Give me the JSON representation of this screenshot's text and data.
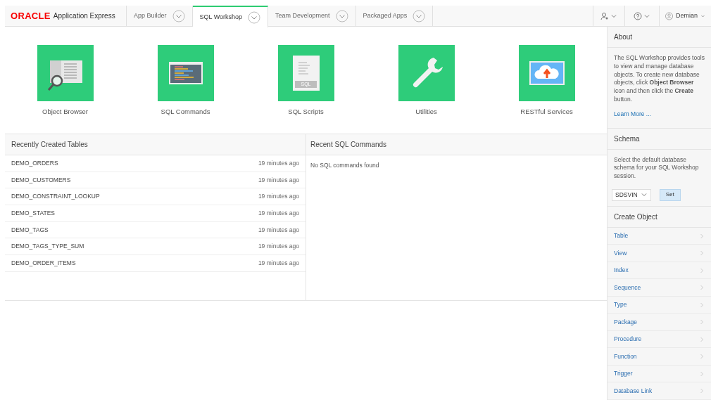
{
  "header": {
    "logo": "ORACLE",
    "product": "Application Express",
    "tabs": [
      {
        "label": "App Builder",
        "selected": false
      },
      {
        "label": "SQL Workshop",
        "selected": true
      },
      {
        "label": "Team Development",
        "selected": false
      },
      {
        "label": "Packaged Apps",
        "selected": false
      }
    ],
    "user": "Demian"
  },
  "tiles": [
    {
      "label": "Object Browser",
      "kind": "browser"
    },
    {
      "label": "SQL Commands",
      "kind": "commands"
    },
    {
      "label": "SQL Scripts",
      "kind": "scripts",
      "badge": "SQL"
    },
    {
      "label": "Utilities",
      "kind": "wrench"
    },
    {
      "label": "RESTful Services",
      "kind": "cloud"
    }
  ],
  "recent_tables": {
    "title": "Recently Created Tables",
    "rows": [
      {
        "name": "DEMO_ORDERS",
        "time": "19 minutes ago"
      },
      {
        "name": "DEMO_CUSTOMERS",
        "time": "19 minutes ago"
      },
      {
        "name": "DEMO_CONSTRAINT_LOOKUP",
        "time": "19 minutes ago"
      },
      {
        "name": "DEMO_STATES",
        "time": "19 minutes ago"
      },
      {
        "name": "DEMO_TAGS",
        "time": "19 minutes ago"
      },
      {
        "name": "DEMO_TAGS_TYPE_SUM",
        "time": "19 minutes ago"
      },
      {
        "name": "DEMO_ORDER_ITEMS",
        "time": "19 minutes ago"
      }
    ]
  },
  "recent_commands": {
    "title": "Recent SQL Commands",
    "empty": "No SQL commands found"
  },
  "sidebar": {
    "about": {
      "title": "About",
      "text": "The SQL Workshop provides tools to view and manage database objects. To create new database objects, click **Object Browser** icon and then click the **Create** button.",
      "link": "Learn More ..."
    },
    "schema": {
      "title": "Schema",
      "text": "Select the default database schema for your SQL Workshop session.",
      "value": "SDSVIN",
      "button": "Set"
    },
    "create": {
      "title": "Create Object",
      "items": [
        "Table",
        "View",
        "Index",
        "Sequence",
        "Type",
        "Package",
        "Procedure",
        "Function",
        "Trigger",
        "Database Link"
      ]
    }
  }
}
